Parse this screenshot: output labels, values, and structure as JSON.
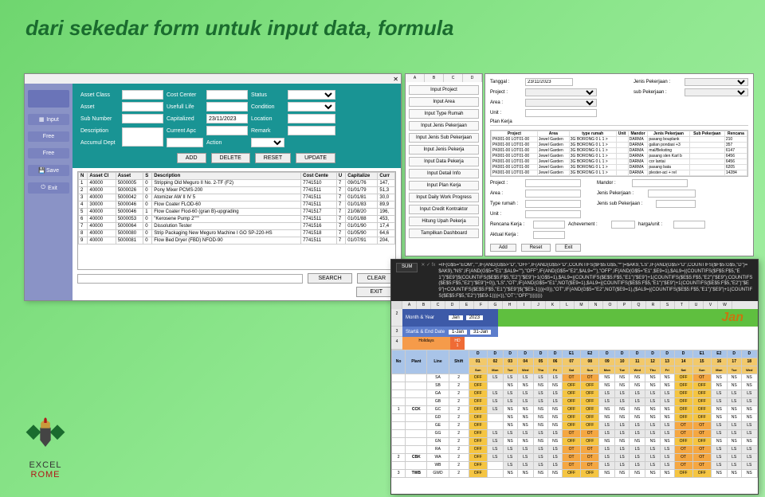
{
  "title": "dari sekedar form untuk input data, formula",
  "form": {
    "labels": {
      "asset_class": "Asset Class",
      "asset": "Asset",
      "sub_number": "Sub Number",
      "description": "Description",
      "cost_center": "Cost Center",
      "useful_life": "Usefull Life",
      "capitalized": "Capitalized",
      "current_apc": "Current Apc",
      "accumul_dept": "Accumul Dept",
      "status": "Status",
      "condition": "Condition",
      "location": "Location",
      "remark": "Remark",
      "action": "Action"
    },
    "capitalized_value": "23/11/2023",
    "buttons": {
      "add": "ADD",
      "delete": "DELETE",
      "reset": "RESET",
      "update": "UPDATE",
      "search": "SEARCH",
      "clear": "CLEAR",
      "exit": "EXIT"
    },
    "side": {
      "input": "Input",
      "free1": "Free",
      "free2": "Free",
      "save": "Save",
      "exit": "Exit"
    },
    "grid_headers": [
      "N",
      "Asset Cl",
      "Asset",
      "S",
      "Description",
      "Cost Cente",
      "U",
      "Capitalize",
      "Curr"
    ],
    "grid_rows": [
      [
        "1",
        "40000",
        "5000005",
        "0",
        "Stripping Old Meguro II No. 2-TF (F2)",
        "7741510",
        "7",
        "09/01/76",
        "147,"
      ],
      [
        "2",
        "40000",
        "5000026",
        "0",
        "Pony Mixer PCMS-200",
        "7741511",
        "7",
        "01/01/79",
        "51,3"
      ],
      [
        "3",
        "40000",
        "5000042",
        "0",
        "Atomizer AW II IV 5",
        "7741511",
        "7",
        "01/01/81",
        "30,0"
      ],
      [
        "4",
        "30000",
        "5000046",
        "0",
        "Flow Coater FLOD-60",
        "7741511",
        "7",
        "01/01/83",
        "89,9"
      ],
      [
        "5",
        "40000",
        "5000046",
        "1",
        "Flow Coater Flod-60 (gran B)-upgrading",
        "7741517",
        "7",
        "21/08/20",
        "196,"
      ],
      [
        "6",
        "40000",
        "5000053",
        "0",
        "\"Kerosene Pump 2\"\"\"",
        "7741511",
        "7",
        "01/01/88",
        "453,"
      ],
      [
        "7",
        "40000",
        "5000064",
        "0",
        "Dissolution Tester",
        "7741516",
        "7",
        "01/01/90",
        "17,4"
      ],
      [
        "8",
        "40000",
        "5000080",
        "0",
        "Strip Packaging New Meguro Machine I GO SP-220-HS",
        "7741518",
        "7",
        "01/05/90",
        "64,6"
      ],
      [
        "9",
        "40000",
        "5000081",
        "0",
        "Flow Bed Dryer (FBD) NFOD-90",
        "7741511",
        "7",
        "01/07/91",
        "204,"
      ]
    ]
  },
  "mid": {
    "cols": [
      "A",
      "B",
      "C",
      "D"
    ],
    "buttons": [
      "Input Project",
      "Input Area",
      "Input Type Rumah",
      "Input Jenis Pekerjaan",
      "Input Jenis Sub Pekerjaan",
      "Input Jenis Pekerja",
      "Input Data Pekerja",
      "Input Detail Info",
      "Input Plan Kerja",
      "Input Daily Work Progress",
      "Input Credit Kontraktor",
      "Hitung Upah Pekerja",
      "Tampilkan Dashboard"
    ]
  },
  "rt": {
    "labels": {
      "tanggal": "Tanggal :",
      "project": "Project :",
      "area": "Area :",
      "unit": "Unit :",
      "jenis_pek": "Jenis Pekerjaan :",
      "sub_pek": "sub Pekerjaan :",
      "plan_kerja": "Plan Kerja",
      "type_rumah": "Type rumah :",
      "mandor": "Mandor :",
      "jenis_sub": "Jenis sub Pekerjaan :",
      "rencana": "Rencana Kerja :",
      "achievement": "Achevement :",
      "harga": "harga/unit :",
      "aktual": "Aktual Kerja :"
    },
    "tanggal_val": "23/11/2023",
    "plan_headers": [
      "Project",
      "Area",
      "type rumah",
      "Unit",
      "Mandor",
      "Jenis Pekerjaan",
      "Sub Pekerjaan",
      "Rencana"
    ],
    "plan_rows": [
      [
        "PK001-00 LOT01-00",
        "Jewel Garden",
        "3G BORONG 0 L 1 >",
        "",
        "DARMA",
        "pasang bouplank",
        "",
        "210"
      ],
      [
        "PK001-00 LOT01-00",
        "Jewel Garden",
        "3G BORONG 0 L 1 >",
        "",
        "DARMA",
        "galian pondasi +3",
        "",
        "357"
      ],
      [
        "PK001-00 LOT01-00",
        "Jewel Garden",
        "3G BORONG 0 L 1 >",
        "",
        "DARMA",
        "mal/Beksting",
        "",
        "6147"
      ],
      [
        "PK001-00 LOT01-00",
        "Jewel Garden",
        "3G BORONG 0 L 1 >",
        "",
        "DARMA",
        "pasang slen Karl b",
        "",
        "6456"
      ],
      [
        "PK001-00 LOT01-00",
        "Jewel Garden",
        "3G BORONG 0 L 1 >",
        "",
        "DARMA",
        "cor lantai",
        "",
        "6456"
      ],
      [
        "PK001-00 LOT01-00",
        "Jewel Garden",
        "3G BORONG 0 L 1 >",
        "",
        "DARMA",
        "pasang bata",
        "",
        "6205"
      ],
      [
        "PK001-00 LOT01-00",
        "Jewel Garden",
        "3G BORONG 0 L 1 >",
        "",
        "DARMA",
        "plester-aci + rel",
        "",
        "14284"
      ]
    ],
    "buttons": {
      "add": "Add",
      "reset": "Reset",
      "exit": "Exit"
    }
  },
  "excel": {
    "cell": "SUM",
    "formula": "=IF(G$5=\"EOM\",\"\",IF(AND(G$5>\"D\",\"OFF\",IF(AND(G$5>\"D\",COUNTIFS($F$5:G$5,\"*\"|=$AK9,\"LS\",IF(AND(G$5>\"D\",COUNTIFS($F$5:G$5,\"D\")=$AK9),\"NS\",IF(AND(G$5=\"E1\",$AL9=\"\"),\"OFF\",IF(AND(G$5=\"E2\",$AL9=\"\"),\"OFF\",IF(AND(G$5=\"E1\",$E9=1),$AL9=|(COUNTIFS($F$5:F$5,\"E1\")\"$E9\"|$(COUNTIFS($E$5:F$5,\"E2\")\"$E9\"|+1(G$5=1),$AL9=|(COUNTIFS($E$5:F$5,\"E1\")\"$E9\"|+1(COUNTIFS($E$5:F$5,\"E2\")\"$E9\");COUNTIFS($E$5:F$5,\"E2\")\"$E9\"|+0)),\"LS\",\"OT\",IF(AND(G$5=\"E1\",NOT($E9=1),$AL9=|(COUNTIFS($E$5:F$5,\"E1\")\"$E9\"|+1(COUNTIFS($E$5:F$5,\"E2\")\"$E9\"|+COUNTIFS($E$5:F$5,\"E1\")\"$E9\"|$(\"$E9-1)))|<0)),\"OT\",IF(AND(G$5=\"E2\",NOT($E9=1),($AL9=|(COUNTIFS($E$5:F$5,\"E1\")\"$E9\"|+1(COUNTIFS($E$5:F$5,\"E2\")\"|$E9-1)))|<)),\"OT\",\"OFF\"))))))))",
    "cols": [
      "",
      "A",
      "B",
      "C",
      "D",
      "E",
      "F",
      "G",
      "H",
      "I",
      "J",
      "K",
      "L",
      "M",
      "N",
      "O",
      "P",
      "Q",
      "R",
      "S",
      "T",
      "U",
      "V",
      "W"
    ],
    "month_year_lab": "Month & Year",
    "month_val": "Jan",
    "year_val": "2023",
    "start_end_lab": "Start& & End Date",
    "start_val": "1-Jan",
    "end_val": "31-Jan",
    "big_month": "Jan",
    "holidays_lab": "Holidays",
    "hd_lab": "HD 1",
    "header_row1": [
      "D",
      "D",
      "D",
      "D",
      "D",
      "D",
      "E1",
      "E2",
      "D",
      "D",
      "D",
      "D",
      "D",
      "D",
      "E1",
      "E2",
      "D",
      "D"
    ],
    "header_row2": [
      "01",
      "02",
      "03",
      "04",
      "05",
      "06",
      "07",
      "08",
      "09",
      "10",
      "11",
      "12",
      "13",
      "14",
      "15",
      "16",
      "17",
      "18"
    ],
    "header_row3": [
      "Sun",
      "Mon",
      "Tue",
      "Wed",
      "Thu",
      "Fri",
      "Sat",
      "Sun",
      "Mon",
      "Tue",
      "Wed",
      "Thu",
      "Fri",
      "Sat",
      "Sun",
      "Mon",
      "Tue",
      "Wed"
    ],
    "head_labels": [
      "No",
      "Plant",
      "Line",
      "Shift"
    ],
    "rows": [
      {
        "no": "",
        "plant": "",
        "line": "SA",
        "shift": "2",
        "cells": [
          "OFF",
          "LS",
          "LS",
          "LS",
          "LS",
          "LS",
          "OT",
          "OT",
          "NS",
          "NS",
          "NS",
          "NS",
          "NS",
          "OFF",
          "OT",
          "NS",
          "NS",
          "NS"
        ]
      },
      {
        "no": "",
        "plant": "",
        "line": "SB",
        "shift": "2",
        "cells": [
          "OFF",
          "",
          "NS",
          "NS",
          "NS",
          "NS",
          "OFF",
          "OFF",
          "NS",
          "NS",
          "NS",
          "NS",
          "NS",
          "OFF",
          "OFF",
          "NS",
          "NS",
          "NS"
        ]
      },
      {
        "no": "",
        "plant": "",
        "line": "GA",
        "shift": "2",
        "cells": [
          "OFF",
          "LS",
          "LS",
          "LS",
          "LS",
          "LS",
          "OFF",
          "OFF",
          "LS",
          "LS",
          "LS",
          "LS",
          "LS",
          "OFF",
          "OFF",
          "LS",
          "LS",
          "LS"
        ]
      },
      {
        "no": "",
        "plant": "",
        "line": "GB",
        "shift": "2",
        "cells": [
          "OFF",
          "LS",
          "LS",
          "LS",
          "LS",
          "LS",
          "OFF",
          "OFF",
          "LS",
          "LS",
          "LS",
          "LS",
          "LS",
          "OFF",
          "OFF",
          "LS",
          "LS",
          "LS"
        ]
      },
      {
        "no": "1",
        "plant": "CCK",
        "line": "GC",
        "shift": "2",
        "cells": [
          "OFF",
          "LS",
          "NS",
          "NS",
          "NS",
          "NS",
          "OFF",
          "OFF",
          "NS",
          "NS",
          "NS",
          "NS",
          "NS",
          "OFF",
          "OFF",
          "NS",
          "NS",
          "NS"
        ]
      },
      {
        "no": "",
        "plant": "",
        "line": "GD",
        "shift": "2",
        "cells": [
          "OFF",
          "",
          "NS",
          "NS",
          "NS",
          "NS",
          "OFF",
          "OFF",
          "NS",
          "NS",
          "NS",
          "NS",
          "NS",
          "OFF",
          "OFF",
          "NS",
          "NS",
          "NS"
        ]
      },
      {
        "no": "",
        "plant": "",
        "line": "GE",
        "shift": "2",
        "cells": [
          "OFF",
          "",
          "NS",
          "NS",
          "NS",
          "NS",
          "OFF",
          "OFF",
          "LS",
          "LS",
          "LS",
          "LS",
          "LS",
          "OT",
          "OT",
          "LS",
          "LS",
          "LS"
        ]
      },
      {
        "no": "",
        "plant": "",
        "line": "GG",
        "shift": "2",
        "cells": [
          "OFF",
          "LS",
          "LS",
          "LS",
          "LS",
          "LS",
          "OT",
          "OT",
          "LS",
          "LS",
          "LS",
          "LS",
          "LS",
          "OT",
          "OT",
          "LS",
          "LS",
          "LS"
        ]
      },
      {
        "no": "",
        "plant": "",
        "line": "GN",
        "shift": "2",
        "cells": [
          "OFF",
          "LS",
          "NS",
          "NS",
          "NS",
          "NS",
          "OFF",
          "OFF",
          "NS",
          "NS",
          "NS",
          "NS",
          "NS",
          "OFF",
          "OFF",
          "NS",
          "NS",
          "NS"
        ]
      },
      {
        "no": "",
        "plant": "",
        "line": "RA",
        "shift": "2",
        "cells": [
          "OFF",
          "LS",
          "LS",
          "LS",
          "LS",
          "LS",
          "OT",
          "OT",
          "LS",
          "LS",
          "LS",
          "LS",
          "LS",
          "OT",
          "OT",
          "LS",
          "LS",
          "LS"
        ]
      },
      {
        "no": "2",
        "plant": "CBK",
        "line": "WA",
        "shift": "2",
        "cells": [
          "OFF",
          "LS",
          "LS",
          "LS",
          "LS",
          "LS",
          "OT",
          "OT",
          "LS",
          "LS",
          "LS",
          "LS",
          "LS",
          "OT",
          "OT",
          "LS",
          "LS",
          "LS"
        ]
      },
      {
        "no": "",
        "plant": "",
        "line": "WB",
        "shift": "2",
        "cells": [
          "OFF",
          "",
          "LS",
          "LS",
          "LS",
          "LS",
          "OT",
          "OT",
          "LS",
          "LS",
          "LS",
          "LS",
          "LS",
          "OT",
          "OT",
          "LS",
          "LS",
          "LS"
        ]
      },
      {
        "no": "3",
        "plant": "TWB",
        "line": "GWD",
        "shift": "2",
        "cells": [
          "OFF",
          "",
          "NS",
          "NS",
          "NS",
          "NS",
          "OFF",
          "OFF",
          "NS",
          "NS",
          "NS",
          "NS",
          "NS",
          "OFF",
          "OFF",
          "NS",
          "NS",
          "NS"
        ]
      }
    ]
  },
  "logo": {
    "t1": "EXCEL",
    "t2": "ROME"
  }
}
